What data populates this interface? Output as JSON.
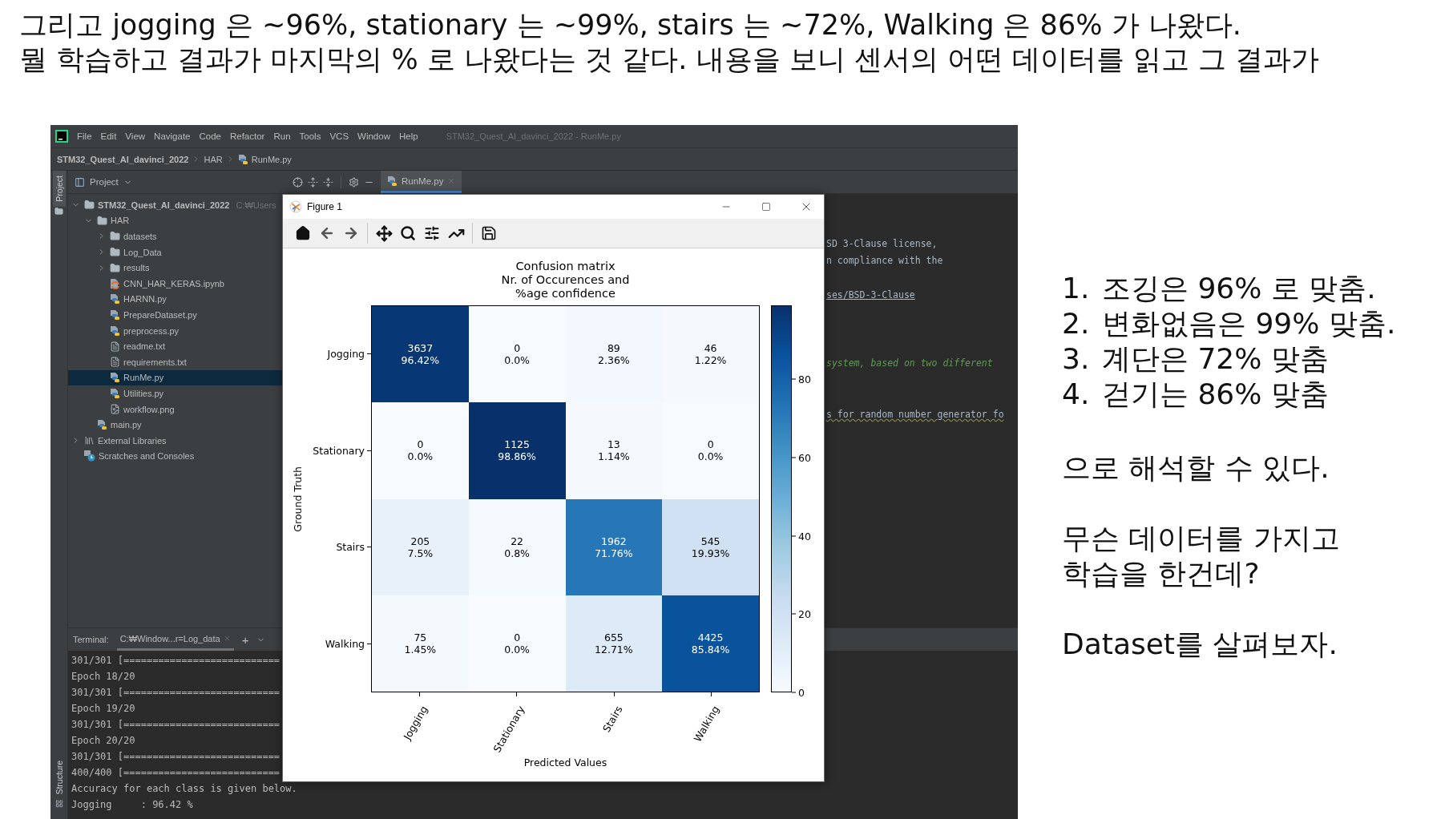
{
  "heading": [
    "그리고 jogging 은 ~96%, stationary 는 ~99%, stairs 는 ~72%, Walking 은 86% 가 나왔다.",
    "뭘 학습하고 결과가 마지막의 % 로 나왔다는 것 같다. 내용을 보니 센서의 어떤 데이터를 읽고 그 결과가"
  ],
  "ide": {
    "menu": [
      "File",
      "Edit",
      "View",
      "Navigate",
      "Code",
      "Refactor",
      "Run",
      "Tools",
      "VCS",
      "Window",
      "Help"
    ],
    "window_title": "STM32_Quest_AI_davinci_2022 - RunMe.py",
    "breadcrumb": [
      "STM32_Quest_AI_davinci_2022",
      "HAR",
      "RunMe.py"
    ],
    "side_tabs": [
      "Project",
      "Structure"
    ],
    "project_panel": {
      "title": "Project",
      "tree": [
        {
          "label": "STM32_Quest_AI_davinci_2022",
          "path": "C:₩Users",
          "kind": "folder",
          "expanded": true,
          "selected": false,
          "children": [
            {
              "label": "HAR",
              "kind": "folder",
              "expanded": true,
              "selected": false,
              "children": [
                {
                  "label": "datasets",
                  "kind": "folder",
                  "expanded": false,
                  "selected": false
                },
                {
                  "label": "Log_Data",
                  "kind": "folder",
                  "expanded": false,
                  "selected": false
                },
                {
                  "label": "results",
                  "kind": "folder",
                  "expanded": false,
                  "selected": false
                },
                {
                  "label": "CNN_HAR_KERAS.ipynb",
                  "kind": "notebook",
                  "selected": false
                },
                {
                  "label": "HARNN.py",
                  "kind": "python",
                  "selected": false
                },
                {
                  "label": "PrepareDataset.py",
                  "kind": "python",
                  "selected": false
                },
                {
                  "label": "preprocess.py",
                  "kind": "python",
                  "selected": false
                },
                {
                  "label": "readme.txt",
                  "kind": "text",
                  "selected": false
                },
                {
                  "label": "requirements.txt",
                  "kind": "text",
                  "selected": false
                },
                {
                  "label": "RunMe.py",
                  "kind": "python",
                  "selected": true
                },
                {
                  "label": "Utilities.py",
                  "kind": "python",
                  "selected": false
                },
                {
                  "label": "workflow.png",
                  "kind": "image",
                  "selected": false
                }
              ]
            },
            {
              "label": "main.py",
              "kind": "python",
              "selected": false
            }
          ]
        },
        {
          "label": "External Libraries",
          "kind": "library",
          "expanded": false,
          "selected": false
        },
        {
          "label": "Scratches and Consoles",
          "kind": "scratches",
          "selected": false
        }
      ]
    },
    "editor_tabs": [
      {
        "label": "RunMe.py",
        "selected": true
      }
    ],
    "code_lines": [
      {
        "text": "SD 3-Clause license,",
        "kind": "plain"
      },
      {
        "text": "n compliance with the",
        "kind": "plain"
      },
      {
        "text": "ses/BSD-3-Clause",
        "kind": "link"
      },
      {
        "text": "system, based on two different",
        "kind": "comment"
      },
      {
        "text": "s for random number generator fo",
        "kind": "warning"
      }
    ],
    "terminal": {
      "title": "Terminal:",
      "tabs": [
        {
          "label": "C:₩Window...r=Log_data",
          "selected": true
        }
      ],
      "add": "+",
      "lines": [
        "301/301 [===========================",
        "Epoch 18/20",
        "301/301 [===========================",
        "Epoch 19/20",
        "301/301 [===========================",
        "Epoch 20/20",
        "301/301 [===========================",
        "400/400 [===========================",
        "Accuracy for each class is given below.",
        "Jogging     : 96.42 %"
      ]
    }
  },
  "figure": {
    "title": "Figure 1",
    "plot": {
      "title_lines": [
        "Confusion matrix",
        "Nr. of Occurences and",
        "%age confidence"
      ],
      "ylabel": "Ground Truth",
      "xlabel": "Predicted Values",
      "rows": [
        "Jogging",
        "Stationary",
        "Stairs",
        "Walking"
      ],
      "columns": [
        "Jogging",
        "Stationary",
        "Stairs",
        "Walking"
      ],
      "cells": [
        [
          {
            "count": "3637",
            "percent": "96.42%",
            "color": "#083775"
          },
          {
            "count": "0",
            "percent": "0.0%",
            "color": "#f7fbff"
          },
          {
            "count": "89",
            "percent": "2.36%",
            "color": "#f2f8fd"
          },
          {
            "count": "46",
            "percent": "1.22%",
            "color": "#f5f9fe"
          }
        ],
        [
          {
            "count": "0",
            "percent": "0.0%",
            "color": "#f7fbff"
          },
          {
            "count": "1125",
            "percent": "98.86%",
            "color": "#08306b"
          },
          {
            "count": "13",
            "percent": "1.14%",
            "color": "#f5f9fe"
          },
          {
            "count": "0",
            "percent": "0.0%",
            "color": "#f7fbff"
          }
        ],
        [
          {
            "count": "205",
            "percent": "7.5%",
            "color": "#e8f1fa"
          },
          {
            "count": "22",
            "percent": "0.8%",
            "color": "#f5fafe"
          },
          {
            "count": "1962",
            "percent": "71.76%",
            "color": "#2777b8"
          },
          {
            "count": "545",
            "percent": "19.93%",
            "color": "#cfe1f2"
          }
        ],
        [
          {
            "count": "75",
            "percent": "1.45%",
            "color": "#f4f9fe"
          },
          {
            "count": "0",
            "percent": "0.0%",
            "color": "#f7fbff"
          },
          {
            "count": "655",
            "percent": "12.71%",
            "color": "#ddeaf7"
          },
          {
            "count": "4425",
            "percent": "85.84%",
            "color": "#09539d"
          }
        ]
      ],
      "colorbar_ticks": [
        "80",
        "60",
        "40",
        "20",
        "0"
      ]
    }
  },
  "notes": {
    "list": [
      {
        "number": "1.",
        "text": "조깅은 96% 로 맞춤."
      },
      {
        "number": "2.",
        "text": "변화없음은 99% 맞춤."
      },
      {
        "number": "3.",
        "text": "계단은 72% 맞춤"
      },
      {
        "number": "4.",
        "text": "걷기는 86% 맞춤"
      }
    ],
    "paragraphs": [
      "으로 해석할 수 있다.",
      "무슨 데이터를 가지고\n학습을 한건데?",
      "Dataset를 살펴보자."
    ]
  }
}
